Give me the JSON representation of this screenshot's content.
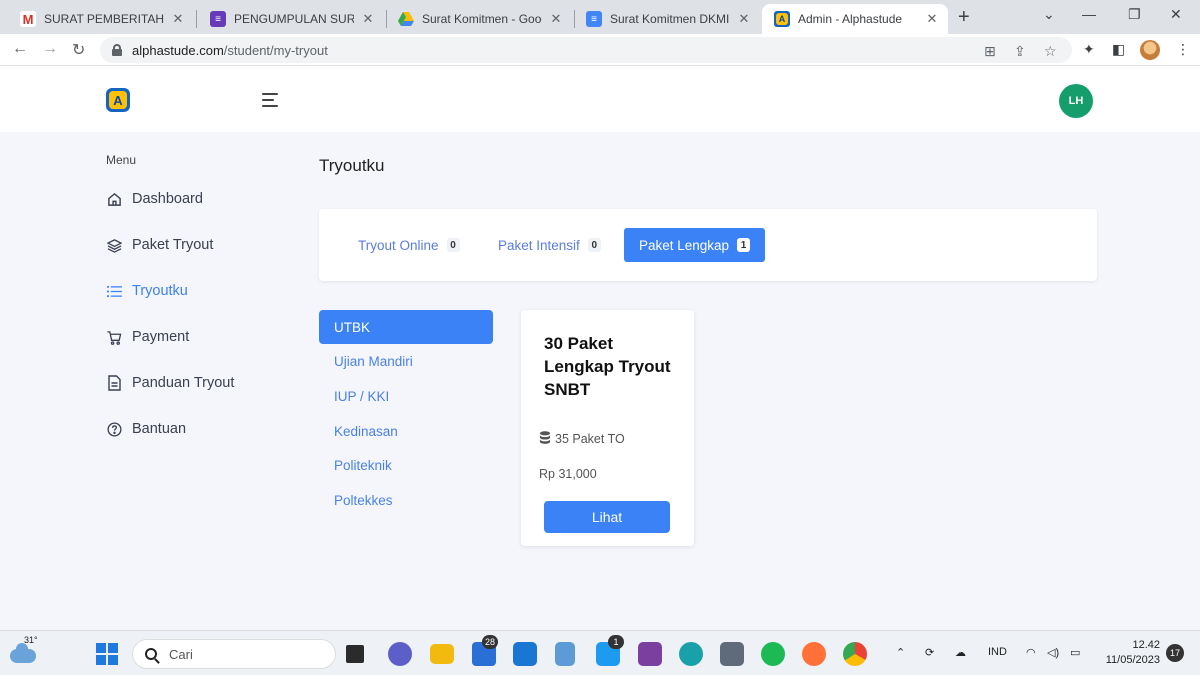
{
  "browser": {
    "tabs": [
      {
        "title": "SURAT PEMBERITAHUAN P",
        "icon": "gmail-icon",
        "color": "#d93025",
        "glyph": "M"
      },
      {
        "title": "PENGUMPULAN SURAT K",
        "icon": "forms-icon",
        "color": "#673ab7",
        "glyph": "≡"
      },
      {
        "title": "Surat Komitmen - Google",
        "icon": "drive-icon",
        "color": "#34a853",
        "glyph": "▲"
      },
      {
        "title": "Surat Komitmen DKMI.do",
        "icon": "docs-icon",
        "color": "#4285f4",
        "glyph": "≡"
      },
      {
        "title": "Admin - Alphastude",
        "icon": "alphastude-icon",
        "color": "#1565c0",
        "glyph": "A",
        "active": true
      }
    ],
    "url_host": "alphastude.com",
    "url_path": "/student/my-tryout"
  },
  "header": {
    "avatar_initials": "LH",
    "logo_letter": "A"
  },
  "sidebar": {
    "menu_title": "Menu",
    "items": [
      {
        "label": "Dashboard",
        "icon": "home-icon"
      },
      {
        "label": "Paket Tryout",
        "icon": "layers-icon"
      },
      {
        "label": "Tryoutku",
        "icon": "list-icon",
        "active": true
      },
      {
        "label": "Payment",
        "icon": "cart-icon"
      },
      {
        "label": "Panduan Tryout",
        "icon": "document-icon"
      },
      {
        "label": "Bantuan",
        "icon": "help-icon"
      }
    ]
  },
  "main": {
    "title": "Tryoutku",
    "tabs": [
      {
        "label": "Tryout Online",
        "count": "0"
      },
      {
        "label": "Paket Intensif",
        "count": "0"
      },
      {
        "label": "Paket Lengkap",
        "count": "1",
        "active": true
      }
    ],
    "categories": [
      "UTBK",
      "Ujian Mandiri",
      "IUP / KKI",
      "Kedinasan",
      "Politeknik",
      "Poltekkes"
    ],
    "active_category": "UTBK",
    "package": {
      "title": "30 Paket Lengkap Tryout SNBT",
      "count_text": "35 Paket TO",
      "price": "Rp 31,000",
      "button_label": "Lihat"
    }
  },
  "taskbar": {
    "temperature": "31°",
    "search_placeholder": "Cari",
    "badges": {
      "todo": "28",
      "twitter": "1"
    },
    "language": "IND",
    "time": "12.42",
    "date": "11/05/2023",
    "notifications": "17"
  },
  "colors": {
    "accent": "#3b82f6",
    "avatar": "#159e6b",
    "page_bg": "#f4f6fb"
  }
}
